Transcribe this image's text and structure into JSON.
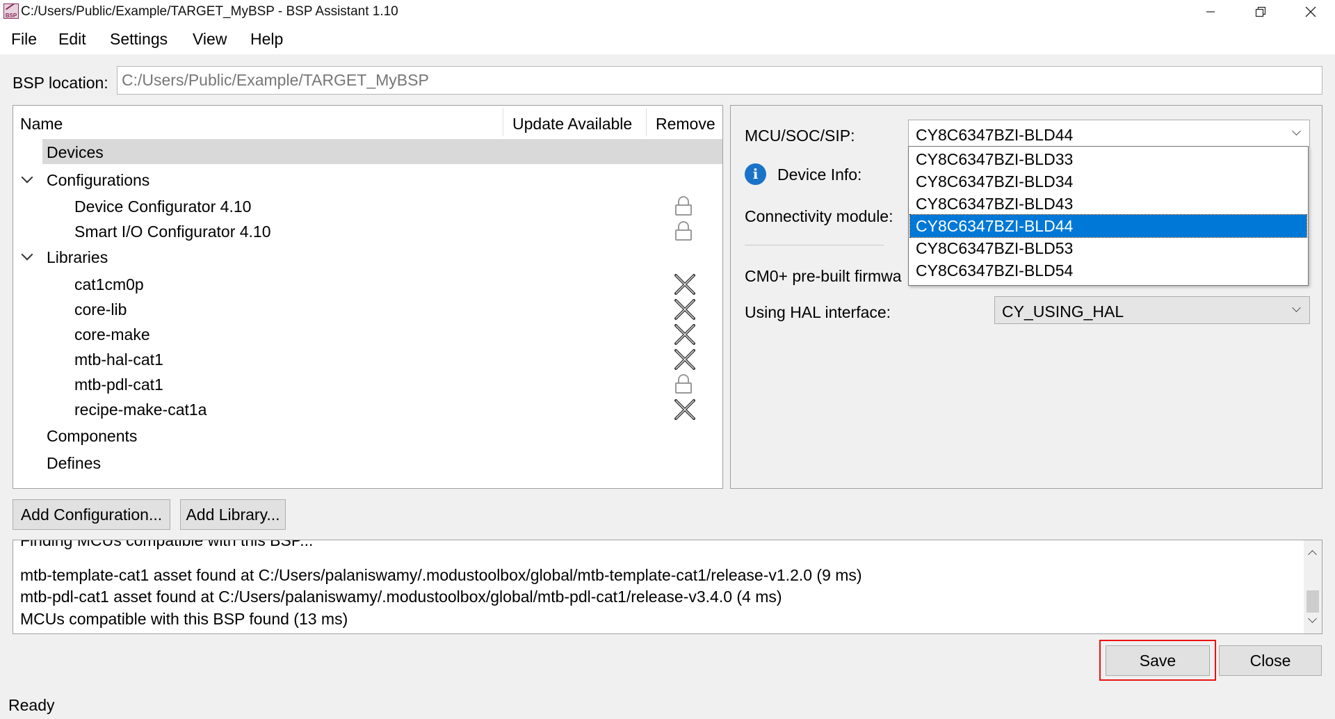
{
  "window": {
    "title": "C:/Users/Public/Example/TARGET_MyBSP - BSP Assistant 1.10",
    "icon_text": "BSP",
    "controls": [
      "minimize-icon",
      "restore-icon",
      "close-icon"
    ]
  },
  "menu": [
    "File",
    "Edit",
    "Settings",
    "View",
    "Help"
  ],
  "bsp_location": {
    "label": "BSP location:",
    "value": "C:/Users/Public/Example/TARGET_MyBSP"
  },
  "tree": {
    "columns": [
      "Name",
      "Update Available",
      "Remove"
    ],
    "rows": [
      {
        "label": "Devices",
        "level": 0,
        "selected": true
      },
      {
        "label": "Configurations",
        "level": 0,
        "expanded": true
      },
      {
        "label": "Device Configurator 4.10",
        "level": 1,
        "remove": "lock"
      },
      {
        "label": "Smart I/O Configurator 4.10",
        "level": 1,
        "remove": "lock"
      },
      {
        "label": "Libraries",
        "level": 0,
        "expanded": true
      },
      {
        "label": "cat1cm0p",
        "level": 1,
        "remove": "x"
      },
      {
        "label": "core-lib",
        "level": 1,
        "remove": "x"
      },
      {
        "label": "core-make",
        "level": 1,
        "remove": "x"
      },
      {
        "label": "mtb-hal-cat1",
        "level": 1,
        "remove": "x"
      },
      {
        "label": "mtb-pdl-cat1",
        "level": 1,
        "remove": "lock"
      },
      {
        "label": "recipe-make-cat1a",
        "level": 1,
        "remove": "x"
      },
      {
        "label": "Components",
        "level": 0
      },
      {
        "label": "Defines",
        "level": 0
      }
    ]
  },
  "device_panel": {
    "mcu_label": "MCU/SOC/SIP:",
    "mcu_value": "CY8C6347BZI-BLD44",
    "device_info_label": "Device Info:",
    "connectivity_label": "Connectivity module:",
    "cm0_label": "CM0+ pre-built firmwa",
    "hal_label": "Using HAL interface:",
    "hal_value": "CY_USING_HAL",
    "dropdown_options": [
      "CY8C6347BZI-BLD33",
      "CY8C6347BZI-BLD34",
      "CY8C6347BZI-BLD43",
      "CY8C6347BZI-BLD44",
      "CY8C6347BZI-BLD53",
      "CY8C6347BZI-BLD54"
    ],
    "dropdown_selected_index": 3
  },
  "buttons": {
    "add_configuration": "Add Configuration...",
    "add_library": "Add Library...",
    "save": "Save",
    "close": "Close"
  },
  "log": {
    "partial_line": "Finding MCUs compatible with this BSP...",
    "lines": [
      "mtb-template-cat1 asset found at C:/Users/palaniswamy/.modustoolbox/global/mtb-template-cat1/release-v1.2.0 (9 ms)",
      "mtb-pdl-cat1 asset found at C:/Users/palaniswamy/.modustoolbox/global/mtb-pdl-cat1/release-v3.4.0 (4 ms)",
      "MCUs compatible with this BSP found (13 ms)"
    ]
  },
  "status": "Ready",
  "colors": {
    "selection": "#0078d7",
    "highlight_box": "#ee1111",
    "info_icon": "#1a73c8"
  }
}
